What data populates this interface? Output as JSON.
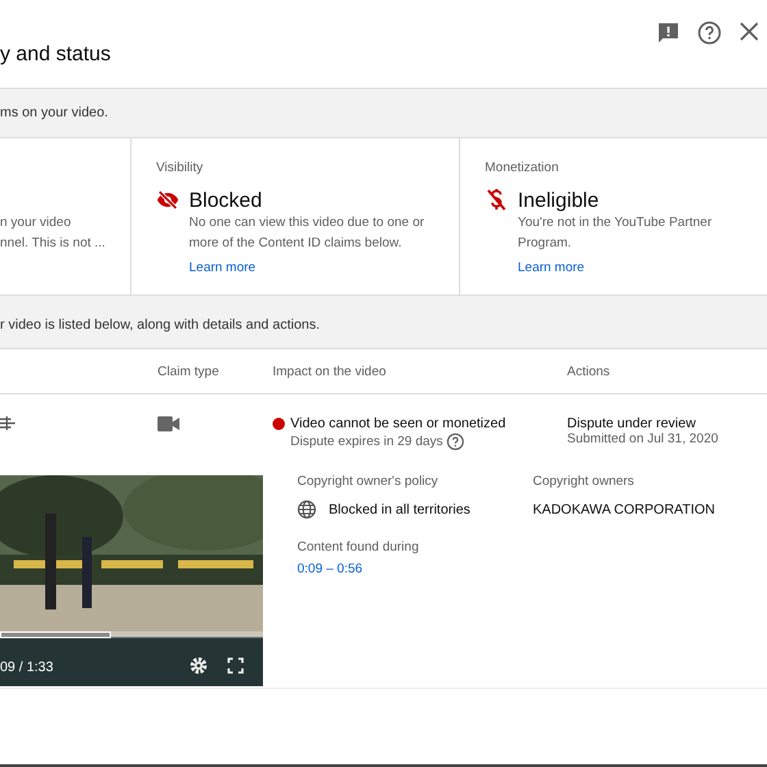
{
  "dialog": {
    "title": "y and status"
  },
  "summary_banner": "ms on your video.",
  "status_cards": [
    {
      "kind": "partial",
      "lines": [
        "n your video",
        "nnel. This is not ..."
      ]
    },
    {
      "label": "Visibility",
      "kind": "blocked",
      "heading": "Blocked",
      "description": "No one can view this video due to one or more of the Content ID claims below.",
      "link": "Learn more"
    },
    {
      "label": "Monetization",
      "kind": "ineligible",
      "heading": "Ineligible",
      "description": "You're not in the YouTube Partner Program.",
      "link": "Learn more"
    }
  ],
  "claims_banner": "r video is listed below, along with details and actions.",
  "table": {
    "columns": [
      "Claim type",
      "Impact on the video",
      "Actions"
    ],
    "rows": [
      {
        "impact": "Video cannot be seen or monetized",
        "color": "#cc0000",
        "impact_note": "Dispute expires in 29 days",
        "action": "Dispute under review",
        "action_note": "Submitted on Jul 31, 2020",
        "player": {
          "time": "09 / 1:33",
          "level": 0.42
        },
        "policy_label": "Copyright owner's policy",
        "policy": "Blocked in all territories",
        "found_label": "Content found during",
        "found": "0:09 – 0:56",
        "owners_label": "Copyright owners",
        "owners": "KADOKAWA CORPORATION"
      }
    ]
  }
}
